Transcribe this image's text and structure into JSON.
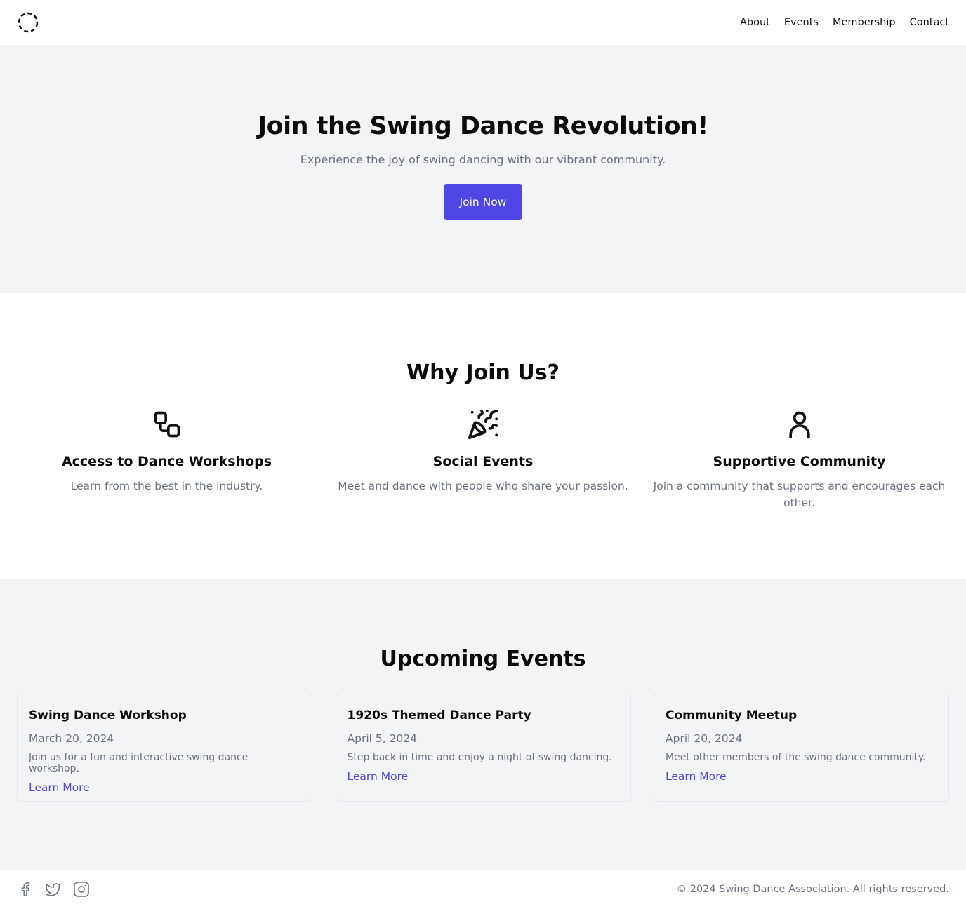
{
  "header": {
    "logo_icon": "dashed-circle-icon",
    "nav": [
      {
        "label": "About"
      },
      {
        "label": "Events"
      },
      {
        "label": "Membership"
      },
      {
        "label": "Contact"
      }
    ]
  },
  "hero": {
    "title": "Join the Swing Dance Revolution!",
    "subtitle": "Experience the joy of swing dancing with our vibrant community.",
    "cta_label": "Join Now",
    "accent_color": "#4f46e5"
  },
  "features": {
    "heading": "Why Join Us?",
    "items": [
      {
        "icon": "workflow-icon",
        "title": "Access to Dance Workshops",
        "description": "Learn from the best in the industry."
      },
      {
        "icon": "party-popper-icon",
        "title": "Social Events",
        "description": "Meet and dance with people who share your passion."
      },
      {
        "icon": "user-icon",
        "title": "Supportive Community",
        "description": "Join a community that supports and encourages each other."
      }
    ]
  },
  "events": {
    "heading": "Upcoming Events",
    "items": [
      {
        "title": "Swing Dance Workshop",
        "date": "March 20, 2024",
        "description": "Join us for a fun and interactive swing dance workshop.",
        "link_label": "Learn More"
      },
      {
        "title": "1920s Themed Dance Party",
        "date": "April 5, 2024",
        "description": "Step back in time and enjoy a night of swing dancing.",
        "link_label": "Learn More"
      },
      {
        "title": "Community Meetup",
        "date": "April 20, 2024",
        "description": "Meet other members of the swing dance community.",
        "link_label": "Learn More"
      }
    ]
  },
  "footer": {
    "social": [
      {
        "icon": "facebook-icon"
      },
      {
        "icon": "twitter-icon"
      },
      {
        "icon": "instagram-icon"
      }
    ],
    "copyright": "© 2024 Swing Dance Association. All rights reserved."
  }
}
